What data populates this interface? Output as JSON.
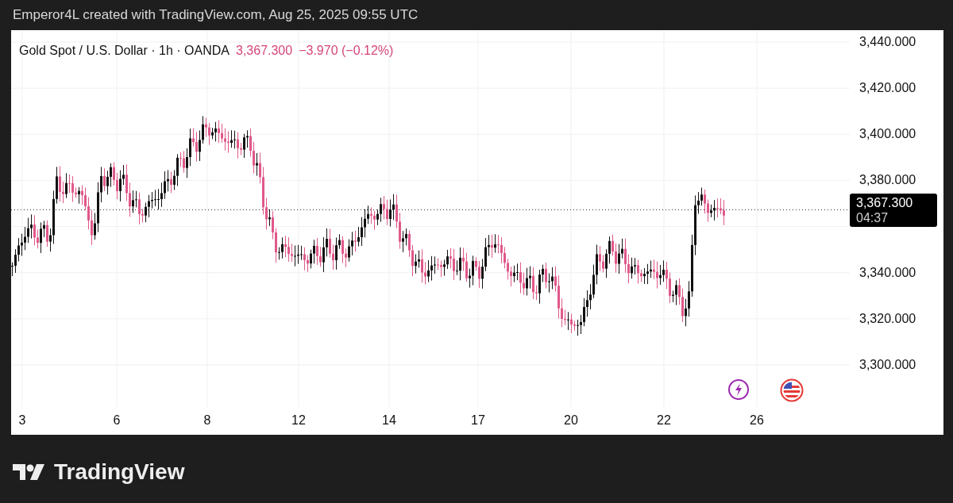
{
  "attribution": "Emperor4L created with TradingView.com, Aug 25, 2025 09:55 UTC",
  "legend": {
    "symbol": "Gold Spot / U.S. Dollar · 1h · OANDA",
    "price": "3,367.300",
    "change": "−3.970 (−0.12%)"
  },
  "price_axis": [
    "3,440.000",
    "3,420.000",
    "3,400.000",
    "3,380.000",
    "3,340.000",
    "3,320.000",
    "3,300.000"
  ],
  "time_axis": [
    "3",
    "6",
    "8",
    "12",
    "14",
    "17",
    "20",
    "22",
    "26"
  ],
  "last_price_tag": {
    "price": "3,367.300",
    "countdown": "04:37"
  },
  "events": [
    {
      "kind": "lightning"
    },
    {
      "kind": "flag"
    }
  ],
  "brand": "TradingView"
}
